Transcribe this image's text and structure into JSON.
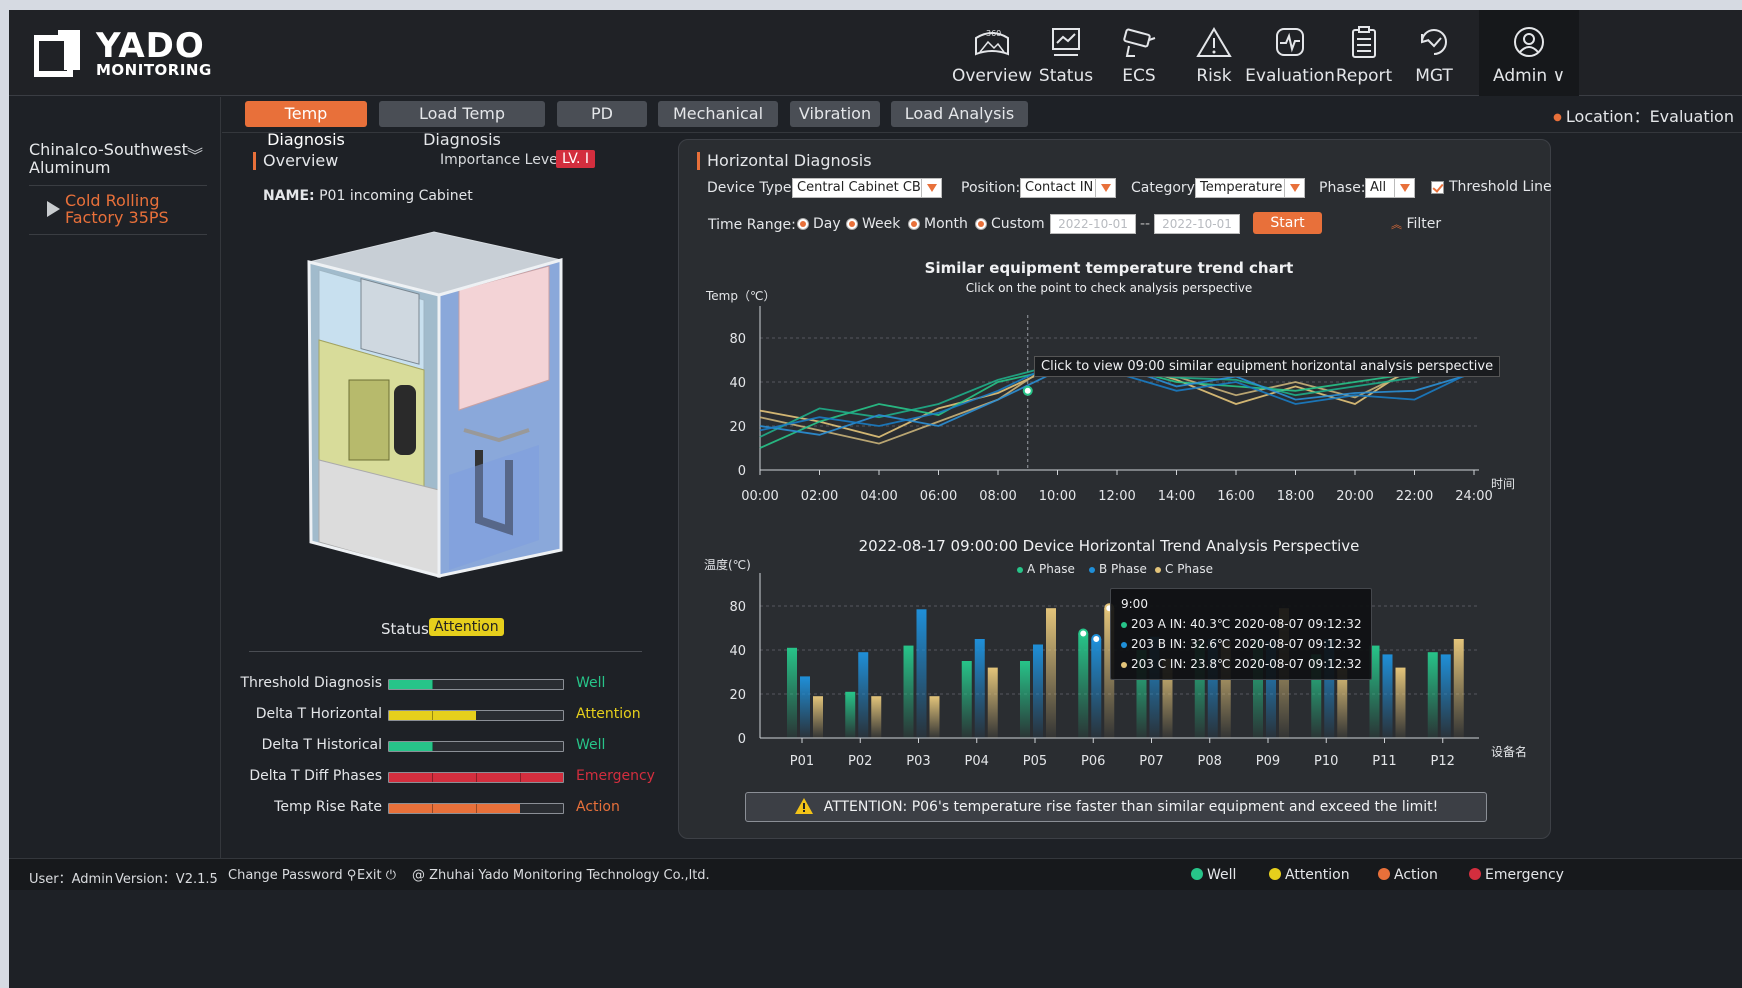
{
  "brand": {
    "name": "YADO",
    "sub": "MONITORING"
  },
  "nav": [
    {
      "label": "Overview",
      "icon": "overview-360-icon"
    },
    {
      "label": "Status",
      "icon": "status-monitor-icon"
    },
    {
      "label": "ECS",
      "icon": "camera-icon"
    },
    {
      "label": "Risk",
      "icon": "warning-icon"
    },
    {
      "label": "Evaluation",
      "icon": "evaluation-icon"
    },
    {
      "label": "Report",
      "icon": "report-icon"
    },
    {
      "label": "MGT",
      "icon": "mgt-icon"
    }
  ],
  "user_menu": {
    "label": "Admin ∨",
    "icon": "user-icon"
  },
  "sidebar": {
    "root": "Chinalco-Southwest Aluminum",
    "child": "Cold Rolling Factory 35PS"
  },
  "tabs": [
    "Temp Diagnosis",
    "Load Temp Diagnosis",
    "PD",
    "Mechanical",
    "Vibration",
    "Load Analysis"
  ],
  "location": "Location：Evaluation",
  "overview": {
    "title": "Overview",
    "importance_label": "Importance Level",
    "importance_value": "LV. I",
    "name_label": "NAME:",
    "name_value": "P01 incoming Cabinet",
    "status_label": "Status",
    "status_value": "Attention"
  },
  "diagnostics": [
    {
      "label": "Threshold Diagnosis",
      "value": "Well",
      "level": 0.25,
      "color": "#27c489"
    },
    {
      "label": "Delta T Horizontal",
      "value": "Attention",
      "level": 0.5,
      "color": "#e6cf1c"
    },
    {
      "label": "Delta T Historical",
      "value": "Well",
      "level": 0.25,
      "color": "#27c489"
    },
    {
      "label": "Delta T Diff Phases",
      "value": "Emergency",
      "level": 1.0,
      "color": "#d32e3e"
    },
    {
      "label": "Temp Rise Rate",
      "value": "Action",
      "level": 0.75,
      "color": "#e8703a"
    }
  ],
  "horizontal": {
    "title": "Horizontal Diagnosis",
    "device_type_label": "Device Type:",
    "device_type_value": "Central Cabinet CB",
    "position_label": "Position:",
    "position_value": "Contact IN",
    "category_label": "Category:",
    "category_value": "Temperature",
    "phase_label": "Phase:",
    "phase_value": "All",
    "threshold_label": "Threshold Line",
    "time_range_label": "Time Range:",
    "ranges": [
      "Day",
      "Week",
      "Month",
      "Custom"
    ],
    "date_from": "2022-10-01",
    "date_to": "2022-10-01",
    "date_sep": "--",
    "start_label": "Start",
    "filter_label": "Filter"
  },
  "chart_data": [
    {
      "type": "line",
      "title": "Similar equipment temperature trend chart",
      "subtitle": "Click on the point to check analysis perspective",
      "ylabel": "Temp（℃）",
      "xlabel": "时间",
      "x": [
        "00:00",
        "02:00",
        "04:00",
        "06:00",
        "08:00",
        "10:00",
        "12:00",
        "14:00",
        "16:00",
        "18:00",
        "20:00",
        "22:00",
        "24:00"
      ],
      "y_ticks": [
        0,
        20,
        40,
        80
      ],
      "tooltip": "Click to view 09:00 similar equipment horizontal analysis perspective",
      "highlight_x": "09:00",
      "series": [
        {
          "color": "#e3c47a",
          "values": [
            27,
            22,
            15,
            28,
            35,
            55,
            58,
            42,
            30,
            38,
            30,
            55,
            52
          ]
        },
        {
          "color": "#c9b27a",
          "values": [
            24,
            18,
            12,
            22,
            32,
            60,
            61,
            45,
            34,
            40,
            33,
            52,
            55
          ]
        },
        {
          "color": "#27c489",
          "values": [
            10,
            22,
            30,
            25,
            40,
            52,
            54,
            40,
            38,
            36,
            40,
            48,
            62
          ]
        },
        {
          "color": "#1fae8a",
          "values": [
            15,
            28,
            24,
            30,
            42,
            56,
            50,
            44,
            42,
            34,
            38,
            44,
            58
          ]
        },
        {
          "color": "#2a8fd6",
          "values": [
            20,
            16,
            25,
            20,
            32,
            50,
            55,
            38,
            45,
            32,
            35,
            36,
            48
          ]
        },
        {
          "color": "#1a7cc4",
          "values": [
            18,
            24,
            20,
            26,
            36,
            58,
            48,
            36,
            40,
            30,
            34,
            32,
            50
          ]
        }
      ]
    },
    {
      "type": "bar",
      "title": "2022-08-17 09:00:00  Device Horizontal Trend Analysis Perspective",
      "ylabel": "温度(℃)",
      "xlabel": "设备名",
      "categories": [
        "P01",
        "P02",
        "P03",
        "P04",
        "P05",
        "P06",
        "P07",
        "P08",
        "P09",
        "P10",
        "P11",
        "P12"
      ],
      "y_ticks": [
        0,
        20,
        40,
        80
      ],
      "series": [
        {
          "name": "A Phase",
          "color": "#27c489",
          "values": [
            42,
            21,
            44,
            35,
            35,
            55,
            40,
            48,
            50,
            38,
            44,
            39
          ]
        },
        {
          "name": "B Phase",
          "color": "#1f8fd8",
          "values": [
            28,
            39,
            77,
            50,
            45,
            50,
            52,
            50,
            48,
            50,
            38,
            38
          ]
        },
        {
          "name": "C Phase",
          "color": "#e3c47a",
          "values": [
            19,
            19,
            19,
            32,
            78,
            78,
            36,
            48,
            78,
            32,
            32,
            50
          ]
        }
      ],
      "tooltip": {
        "title": "9:00",
        "rows": [
          {
            "text": "203 A IN:  40.3℃  2020-08-07  09:12:32",
            "color": "#27c489"
          },
          {
            "text": "203 B IN:  32.6℃  2020-08-07  09:12:32",
            "color": "#1f8fd8"
          },
          {
            "text": "203 C IN:  23.8℃  2020-08-07  09:12:32",
            "color": "#e3c47a"
          }
        ]
      }
    }
  ],
  "alert": "ATTENTION: P06's temperature rise faster than similar equipment and exceed the limit!",
  "footer": {
    "user": "User：Admin",
    "version": "Version：V2.1.5",
    "change_password": "Change Password ⚲",
    "exit": "Exit ⏻",
    "copyright": "@ Zhuhai Yado Monitoring Technology Co.,ltd."
  },
  "status_legend": [
    {
      "label": "Well",
      "color": "#27c489"
    },
    {
      "label": "Attention",
      "color": "#e6cf1c"
    },
    {
      "label": "Action",
      "color": "#e8703a"
    },
    {
      "label": "Emergency",
      "color": "#d32e3e"
    }
  ]
}
